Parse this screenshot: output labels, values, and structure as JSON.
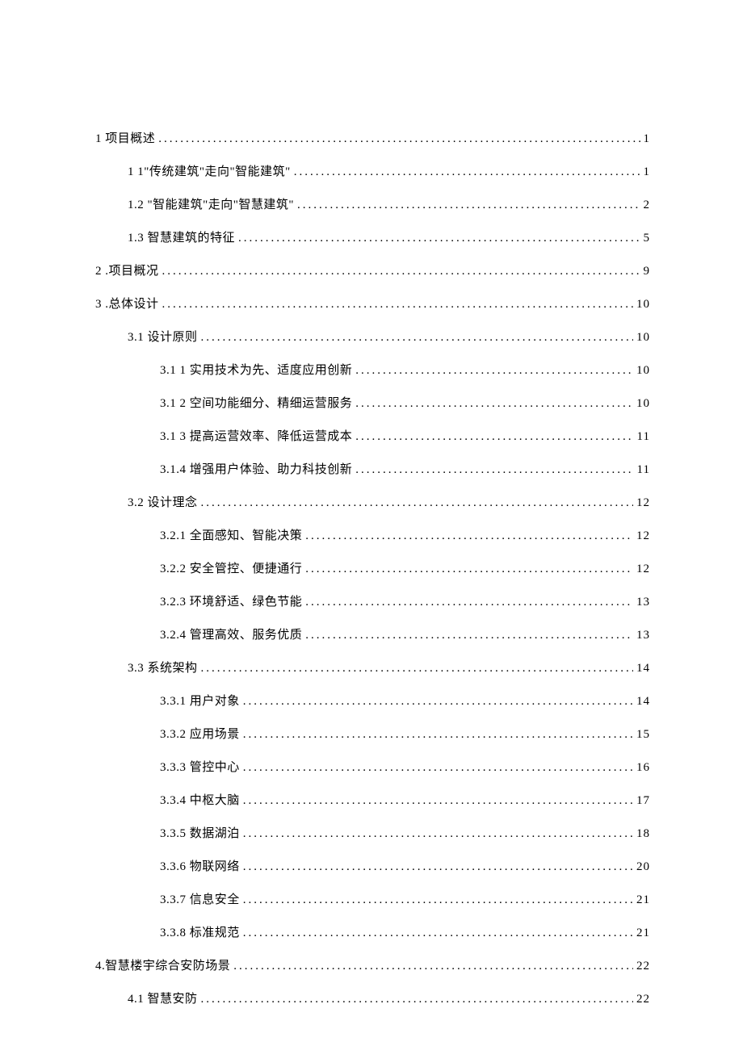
{
  "toc": [
    {
      "indent": 0,
      "label": "1 项目概述",
      "page": "1"
    },
    {
      "indent": 1,
      "label": "1 1\"传统建筑\"走向\"智能建筑\"",
      "page": "1"
    },
    {
      "indent": 1,
      "label": "1.2  \"智能建筑\"走向\"智慧建筑\"",
      "page": "2"
    },
    {
      "indent": 1,
      "label": "1.3  智慧建筑的特征",
      "page": "5"
    },
    {
      "indent": 0,
      "label": "2  .项目概况",
      "page": "9"
    },
    {
      "indent": 0,
      "label": "3  .总体设计",
      "page": "10"
    },
    {
      "indent": 1,
      "label": "3.1 设计原则",
      "page": "10"
    },
    {
      "indent": 2,
      "label": "3.1 1 实用技术为先、适度应用创新",
      "page": "10"
    },
    {
      "indent": 2,
      "label": "3.1 2 空间功能细分、精细运营服务",
      "page": "10"
    },
    {
      "indent": 2,
      "label": "3.1 3 提高运营效率、降低运营成本",
      "page": "11"
    },
    {
      "indent": 2,
      "label": "3.1.4 增强用户体验、助力科技创新",
      "page": "11"
    },
    {
      "indent": 1,
      "label": "3.2 设计理念",
      "page": "12"
    },
    {
      "indent": 2,
      "label": "3.2.1 全面感知、智能决策",
      "page": "12"
    },
    {
      "indent": 2,
      "label": "3.2.2 安全管控、便捷通行",
      "page": "12"
    },
    {
      "indent": 2,
      "label": "3.2.3 环境舒适、绿色节能",
      "page": "13"
    },
    {
      "indent": 2,
      "label": "3.2.4 管理高效、服务优质",
      "page": "13"
    },
    {
      "indent": 1,
      "label": "3.3 系统架构",
      "page": "14"
    },
    {
      "indent": 2,
      "label": "3.3.1 用户对象",
      "page": "14"
    },
    {
      "indent": 2,
      "label": "3.3.2 应用场景",
      "page": "15"
    },
    {
      "indent": 2,
      "label": "3.3.3 管控中心",
      "page": "16"
    },
    {
      "indent": 2,
      "label": "3.3.4 中枢大脑",
      "page": "17"
    },
    {
      "indent": 2,
      "label": "3.3.5 数据湖泊",
      "page": "18"
    },
    {
      "indent": 2,
      "label": "3.3.6 物联网络",
      "page": "20"
    },
    {
      "indent": 2,
      "label": "3.3.7 信息安全",
      "page": "21"
    },
    {
      "indent": 2,
      "label": "3.3.8 标准规范",
      "page": "21"
    },
    {
      "indent": 0,
      "label": "4.智慧楼宇综合安防场景",
      "page": "22"
    },
    {
      "indent": 1,
      "label": "4.1 智慧安防",
      "page": "22"
    }
  ]
}
